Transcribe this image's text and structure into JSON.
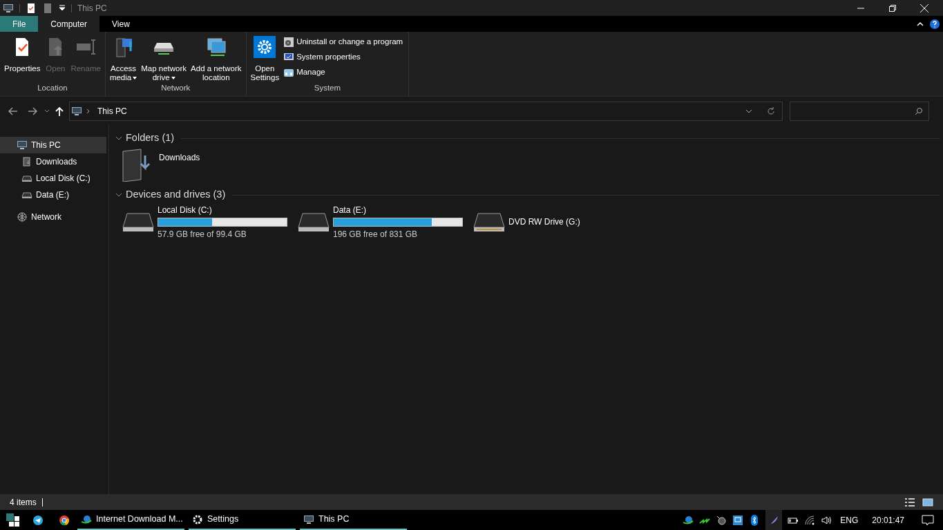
{
  "title_bar": {
    "title": "This PC"
  },
  "ribbon": {
    "tabs": [
      {
        "label": "File",
        "kind": "menu",
        "selected": false
      },
      {
        "label": "Computer",
        "kind": "tab",
        "selected": true
      },
      {
        "label": "View",
        "kind": "tab",
        "selected": false
      }
    ],
    "groups": [
      {
        "label": "Location",
        "items": [
          {
            "kind": "large",
            "lines": [
              "Properties"
            ],
            "disabled": false
          },
          {
            "kind": "large",
            "lines": [
              "Open"
            ],
            "disabled": true
          },
          {
            "kind": "large",
            "lines": [
              "Rename"
            ],
            "disabled": true
          }
        ]
      },
      {
        "label": "Network",
        "items": [
          {
            "kind": "large",
            "lines": [
              "Access",
              "media"
            ],
            "disabled": false,
            "dropdown": true
          },
          {
            "kind": "large",
            "lines": [
              "Map network",
              "drive"
            ],
            "disabled": false,
            "dropdown": true
          },
          {
            "kind": "large",
            "lines": [
              "Add a network",
              "location"
            ],
            "disabled": false
          }
        ]
      },
      {
        "label": "System",
        "items": [
          {
            "kind": "large",
            "lines": [
              "Open",
              "Settings"
            ],
            "disabled": false
          },
          {
            "kind": "small",
            "lines": [
              "Uninstall or change a program"
            ],
            "disabled": false
          },
          {
            "kind": "small",
            "lines": [
              "System properties"
            ],
            "disabled": false
          },
          {
            "kind": "small",
            "lines": [
              "Manage"
            ],
            "disabled": false
          }
        ]
      }
    ]
  },
  "address_bar": {
    "path": "This PC"
  },
  "nav_pane": {
    "items": [
      {
        "label": "This PC",
        "kind": "pc",
        "selected": true,
        "children": [
          {
            "label": "Downloads",
            "kind": "folder",
            "selected": false
          },
          {
            "label": "Local Disk (C:)",
            "kind": "disk",
            "selected": false
          },
          {
            "label": "Data (E:)",
            "kind": "disk",
            "selected": false
          }
        ]
      },
      {
        "label": "Network",
        "kind": "network",
        "selected": false
      }
    ]
  },
  "sections": [
    {
      "title": "Folders (1)",
      "items": [
        {
          "kind": "folder",
          "name": "Downloads"
        }
      ]
    },
    {
      "title": "Devices and drives (3)",
      "items": [
        {
          "kind": "disk",
          "name": "Local Disk (C:)",
          "level": 0.417,
          "reading": "57.9 GB free of 99.4 GB"
        },
        {
          "kind": "disk",
          "name": "Data (E:)",
          "level": 0.764,
          "reading": "196 GB free of 831 GB"
        },
        {
          "kind": "optical",
          "name": "DVD RW Drive (G:)"
        }
      ]
    }
  ],
  "status_bar": {
    "count": "4 items"
  },
  "taskbar": {
    "apps": [
      {
        "kind": "telegram"
      },
      {
        "kind": "chrome"
      },
      {
        "kind": "idm",
        "label": "Internet Download M..."
      },
      {
        "kind": "settings",
        "label": "Settings"
      },
      {
        "kind": "explorer",
        "label": "This PC"
      }
    ],
    "language": "ENG",
    "time": "20:01:47"
  }
}
